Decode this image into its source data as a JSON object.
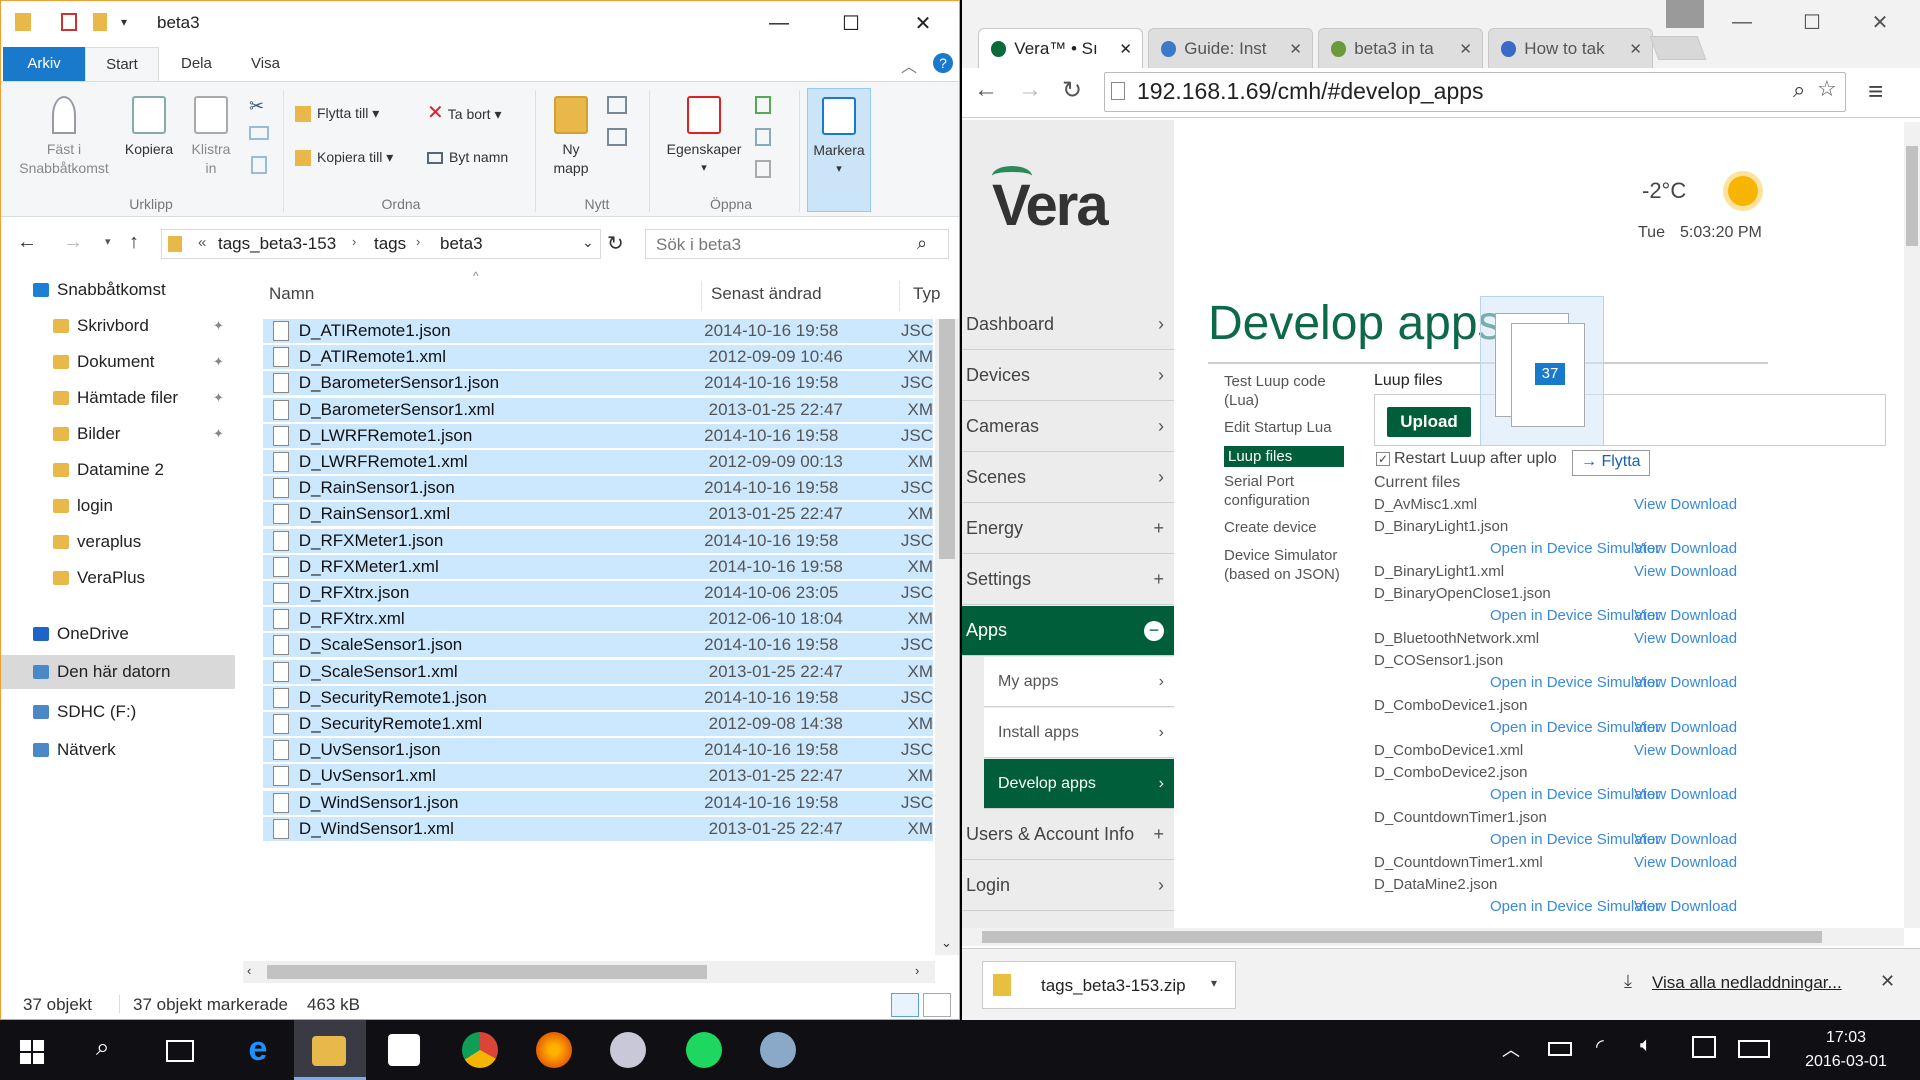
{
  "explorer": {
    "title": "beta3",
    "ribbon_tabs": [
      "Arkiv",
      "Start",
      "Dela",
      "Visa"
    ],
    "ribbon": {
      "pin": "Fäst i Snabbåtkomst",
      "copy": "Kopiera",
      "paste": "Klistra in",
      "group_clipboard": "Urklipp",
      "move_to": "Flytta till",
      "copy_to": "Kopiera till",
      "delete": "Ta bort",
      "rename": "Byt namn",
      "group_organize": "Ordna",
      "new_folder": "Ny mapp",
      "group_new": "Nytt",
      "properties": "Egenskaper",
      "group_open": "Öppna",
      "select": "Markera"
    },
    "address": {
      "sep": "«",
      "crumbs": [
        "tags_beta3-153",
        "tags",
        "beta3"
      ],
      "search_placeholder": "Sök i beta3"
    },
    "nav": [
      {
        "label": "Snabbåtkomst",
        "pinned": false
      },
      {
        "label": "Skrivbord",
        "pinned": true
      },
      {
        "label": "Dokument",
        "pinned": true
      },
      {
        "label": "Hämtade filer",
        "pinned": true
      },
      {
        "label": "Bilder",
        "pinned": true
      },
      {
        "label": "Datamine 2",
        "pinned": false
      },
      {
        "label": "login",
        "pinned": false
      },
      {
        "label": "veraplus",
        "pinned": false
      },
      {
        "label": "VeraPlus",
        "pinned": false
      },
      {
        "label": "OneDrive",
        "pinned": false
      },
      {
        "label": "Den här datorn",
        "pinned": false
      },
      {
        "label": "SDHC (F:)",
        "pinned": false
      },
      {
        "label": "Nätverk",
        "pinned": false
      }
    ],
    "columns": {
      "name": "Namn",
      "date": "Senast ändrad",
      "type": "Typ"
    },
    "files": [
      {
        "name": "D_ATIRemote1.json",
        "date": "2014-10-16 19:58",
        "type": "JSC"
      },
      {
        "name": "D_ATIRemote1.xml",
        "date": "2012-09-09 10:46",
        "type": "XM"
      },
      {
        "name": "D_BarometerSensor1.json",
        "date": "2014-10-16 19:58",
        "type": "JSC"
      },
      {
        "name": "D_BarometerSensor1.xml",
        "date": "2013-01-25 22:47",
        "type": "XM"
      },
      {
        "name": "D_LWRFRemote1.json",
        "date": "2014-10-16 19:58",
        "type": "JSC"
      },
      {
        "name": "D_LWRFRemote1.xml",
        "date": "2012-09-09 00:13",
        "type": "XM"
      },
      {
        "name": "D_RainSensor1.json",
        "date": "2014-10-16 19:58",
        "type": "JSC"
      },
      {
        "name": "D_RainSensor1.xml",
        "date": "2013-01-25 22:47",
        "type": "XM"
      },
      {
        "name": "D_RFXMeter1.json",
        "date": "2014-10-16 19:58",
        "type": "JSC"
      },
      {
        "name": "D_RFXMeter1.xml",
        "date": "2014-10-16 19:58",
        "type": "XM"
      },
      {
        "name": "D_RFXtrx.json",
        "date": "2014-10-06 23:05",
        "type": "JSC"
      },
      {
        "name": "D_RFXtrx.xml",
        "date": "2012-06-10 18:04",
        "type": "XM"
      },
      {
        "name": "D_ScaleSensor1.json",
        "date": "2014-10-16 19:58",
        "type": "JSC"
      },
      {
        "name": "D_ScaleSensor1.xml",
        "date": "2013-01-25 22:47",
        "type": "XM"
      },
      {
        "name": "D_SecurityRemote1.json",
        "date": "2014-10-16 19:58",
        "type": "JSC"
      },
      {
        "name": "D_SecurityRemote1.xml",
        "date": "2012-09-08 14:38",
        "type": "XM"
      },
      {
        "name": "D_UvSensor1.json",
        "date": "2014-10-16 19:58",
        "type": "JSC"
      },
      {
        "name": "D_UvSensor1.xml",
        "date": "2013-01-25 22:47",
        "type": "XM"
      },
      {
        "name": "D_WindSensor1.json",
        "date": "2014-10-16 19:58",
        "type": "JSC"
      },
      {
        "name": "D_WindSensor1.xml",
        "date": "2013-01-25 22:47",
        "type": "XM"
      }
    ],
    "status": {
      "count": "37 objekt",
      "selected": "37 objekt markerade",
      "size": "463 kB"
    }
  },
  "chrome": {
    "tabs": [
      {
        "label": "Vera™ • Sı",
        "active": true
      },
      {
        "label": "Guide: Inst",
        "active": false
      },
      {
        "label": "beta3 in ta",
        "active": false
      },
      {
        "label": "How to tak",
        "active": false
      }
    ],
    "url": "192.168.1.69/cmh/#develop_apps",
    "download_file": "tags_beta3-153.zip",
    "show_all_downloads": "Visa alla nedladdningar..."
  },
  "vera": {
    "logo": "Vera",
    "temp": "-2°C",
    "day": "Tue",
    "time": "5:03:20 PM",
    "menu": [
      {
        "label": "Dashboard",
        "icon": "›"
      },
      {
        "label": "Devices",
        "icon": "›"
      },
      {
        "label": "Cameras",
        "icon": "›"
      },
      {
        "label": "Scenes",
        "icon": "›"
      },
      {
        "label": "Energy",
        "icon": "+"
      },
      {
        "label": "Settings",
        "icon": "+"
      },
      {
        "label": "Apps",
        "icon": "−"
      }
    ],
    "submenu": [
      "My apps",
      "Install apps",
      "Develop apps"
    ],
    "menu_bottom": [
      {
        "label": "Users & Account Info",
        "icon": "+"
      },
      {
        "label": "Login",
        "icon": "›"
      }
    ],
    "heading": "Develop apps",
    "dev_links": [
      "Test Luup code (Lua)",
      "Edit Startup Lua",
      "Luup files",
      "Serial Port configuration",
      "Create device",
      "Device Simulator (based on JSON)"
    ],
    "luup_files_title": "Luup files",
    "upload": "Upload",
    "restart": "Restart Luup after uplo",
    "current_files": "Current files",
    "view_download": "View Download",
    "open_sim": "Open in Device Simulator",
    "files": [
      {
        "name": "D_AvMisc1.xml",
        "sim": false
      },
      {
        "name": "D_BinaryLight1.json",
        "sim": true
      },
      {
        "name": "D_BinaryLight1.xml",
        "sim": false
      },
      {
        "name": "D_BinaryOpenClose1.json",
        "sim": true
      },
      {
        "name": "D_BluetoothNetwork.xml",
        "sim": false
      },
      {
        "name": "D_COSensor1.json",
        "sim": true
      },
      {
        "name": "D_ComboDevice1.json",
        "sim": true
      },
      {
        "name": "D_ComboDevice1.xml",
        "sim": false
      },
      {
        "name": "D_ComboDevice2.json",
        "sim": true
      },
      {
        "name": "D_CountdownTimer1.json",
        "sim": true
      },
      {
        "name": "D_CountdownTimer1.xml",
        "sim": false
      },
      {
        "name": "D_DataMine2.json",
        "sim": true
      }
    ],
    "drag_count": "37",
    "drag_action": "Flytta"
  },
  "taskbar": {
    "time": "17:03",
    "date": "2016-03-01"
  }
}
